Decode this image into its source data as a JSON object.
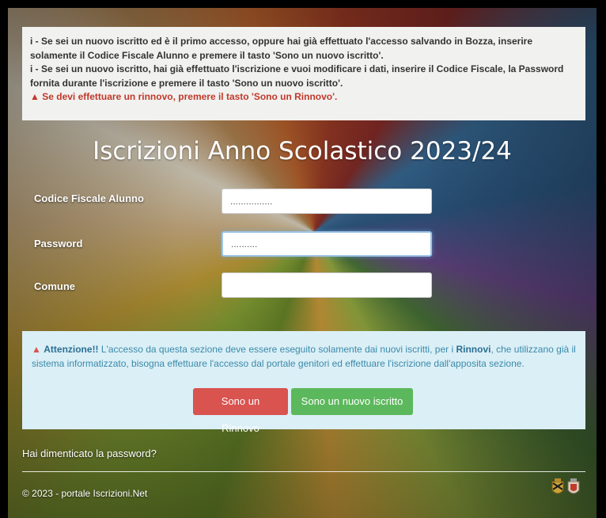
{
  "info": {
    "line1": "i - Se sei un nuovo iscritto ed è il primo accesso, oppure hai già effettuato l'accesso salvando in Bozza, inserire solamente il Codice Fiscale Alunno e premere il tasto 'Sono un nuovo iscritto'.",
    "line2": "i - Se sei un nuovo iscritto, hai già effettuato l'iscrizione e vuoi modificare i dati, inserire il Codice Fiscale, la Password fornita durante l'iscrizione e premere il tasto 'Sono un nuovo iscritto'.",
    "warning": "Se devi effettuare un rinnovo, premere il tasto 'Sono un Rinnovo'."
  },
  "title": "Iscrizioni Anno Scolastico 2023/24",
  "form": {
    "codice_label": "Codice Fiscale Alunno",
    "codice_value": "................",
    "password_label": "Password",
    "password_value": "..........",
    "comune_label": "Comune",
    "comune_value": ""
  },
  "alert": {
    "heading": "Attenzione!!",
    "text_before": " L'accesso da questa sezione deve essere eseguito solamente dai nuovi iscritti, per i ",
    "rinnovi": "Rinnovi",
    "text_after": ", che utilizzano già il sistema informatizzato, bisogna effettuare l'accesso dal portale genitori ed effettuare l'iscrizione dall'apposita sezione."
  },
  "buttons": {
    "rinnovo": "Sono un Rinnovo",
    "nuovo": "Sono un nuovo iscritto"
  },
  "forgot_password": "Hai dimenticato la password?",
  "footer": "© 2023 - portale Iscrizioni.Net",
  "colors": {
    "danger": "#d9534f",
    "success": "#5cb85c",
    "alert_bg": "#dbeff6",
    "info_bg": "#f1f1ef"
  },
  "icons": [
    "warning-icon",
    "info-icon",
    "crest-icon"
  ]
}
